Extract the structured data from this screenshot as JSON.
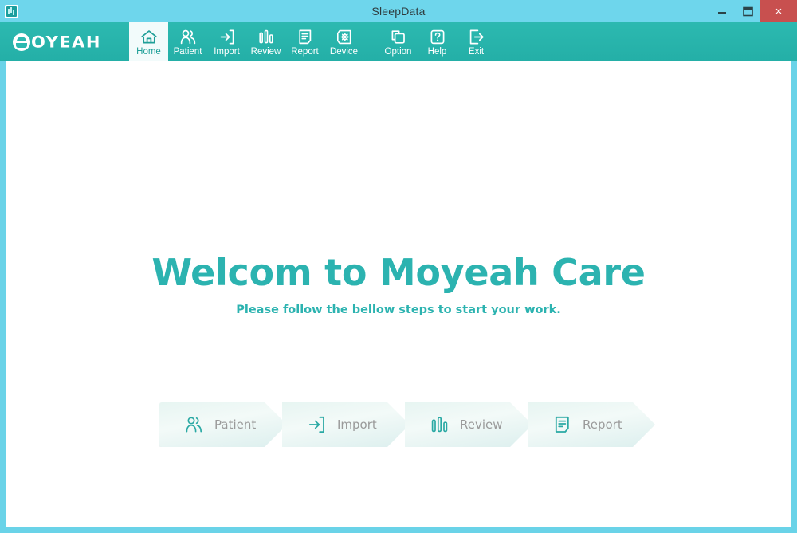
{
  "window": {
    "title": "SleepData",
    "app_icon": "sleepdata-app-icon",
    "controls": {
      "minimize": "minimize-icon",
      "maximize": "maximize-icon",
      "close": "×"
    }
  },
  "brand": {
    "mark": "moyeah-logo-mark",
    "word": "OYEAH"
  },
  "toolbar": {
    "primary_items": [
      {
        "label": "Home",
        "icon": "home-icon",
        "active": true
      },
      {
        "label": "Patient",
        "icon": "patients-icon",
        "active": false
      },
      {
        "label": "Import",
        "icon": "import-icon",
        "active": false
      },
      {
        "label": "Review",
        "icon": "review-chart-icon",
        "active": false
      },
      {
        "label": "Report",
        "icon": "report-document-icon",
        "active": false
      },
      {
        "label": "Device",
        "icon": "device-gear-icon",
        "active": false
      }
    ],
    "secondary_items": [
      {
        "label": "Option",
        "icon": "option-windows-icon",
        "active": false
      },
      {
        "label": "Help",
        "icon": "help-question-icon",
        "active": false
      },
      {
        "label": "Exit",
        "icon": "exit-arrow-icon",
        "active": false
      }
    ]
  },
  "main": {
    "heading": "Welcom to Moyeah Care",
    "subheading": "Please follow the bellow steps to start your work.",
    "steps": [
      {
        "label": "Patient",
        "icon": "patients-icon"
      },
      {
        "label": "Import",
        "icon": "import-icon"
      },
      {
        "label": "Review",
        "icon": "review-chart-icon"
      },
      {
        "label": "Report",
        "icon": "report-document-icon"
      }
    ]
  },
  "colors": {
    "titlebar": "#6ed6ec",
    "toolbar_teal": "#2cb9b0",
    "close_red": "#c8504f",
    "accent_teal": "#2cb3b0",
    "step_fill": "#eaf6f4",
    "step_label_gray": "#9a9a9a"
  }
}
